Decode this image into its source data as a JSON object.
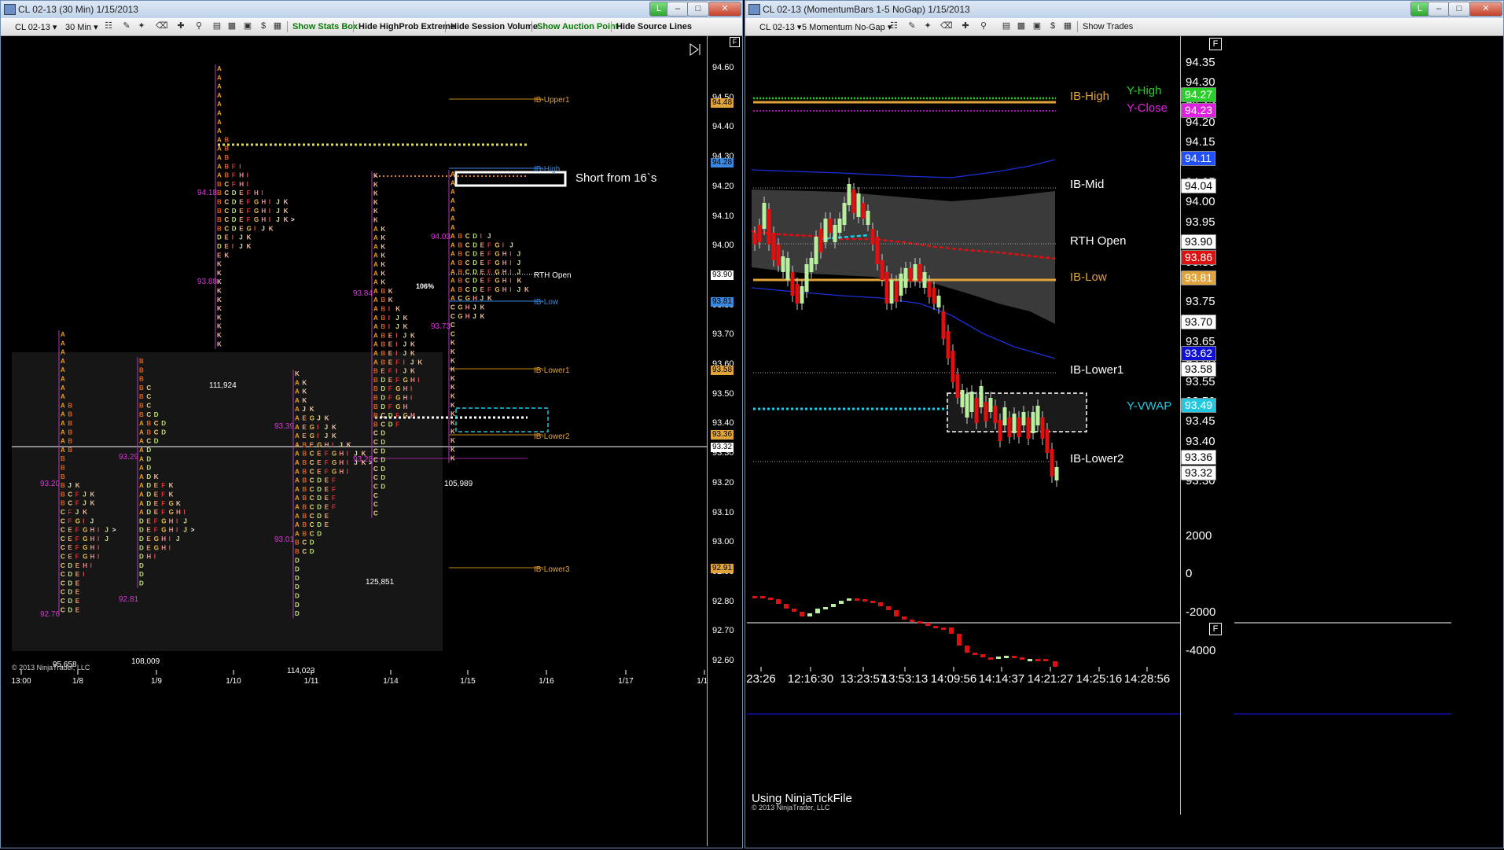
{
  "left_window": {
    "title": "CL 02-13 (30 Min)  1/15/2013",
    "toolbar": {
      "instrument": "CL 02-13",
      "period": "30 Min",
      "buttons": [
        "Show Stats Box",
        "Hide HighProb Extreme",
        "Hide Session Volume",
        "Show Auction Point",
        "Hide Source Lines"
      ]
    },
    "corner_flag": "F",
    "y_ticks": [
      "94.60",
      "94.50",
      "94.40",
      "94.30",
      "94.20",
      "94.10",
      "94.00",
      "93.90",
      "93.80",
      "93.70",
      "93.60",
      "93.50",
      "93.40",
      "93.30",
      "93.20",
      "93.10",
      "93.00",
      "92.90",
      "92.80",
      "92.70",
      "92.60"
    ],
    "price_tags": [
      {
        "label": "94.48",
        "color": "#e0a43a"
      },
      {
        "label": "94.28",
        "color": "#3a88e0"
      },
      {
        "label": "93.90",
        "color": "#ffffff"
      },
      {
        "label": "93.81",
        "color": "#3a88e0"
      },
      {
        "label": "93.58",
        "color": "#e0a43a"
      },
      {
        "label": "93.36",
        "color": "#e0a43a"
      },
      {
        "label": "93.32",
        "color": "#ffffff"
      },
      {
        "label": "92.91",
        "color": "#e0a43a"
      }
    ],
    "x_ticks": [
      "13:00",
      "1/8",
      "1/9",
      "1/10",
      "1/11",
      "1/14",
      "1/15",
      "1/16",
      "1/17",
      "1/18"
    ],
    "level_labels": [
      "IB-Upper1",
      "IB-High",
      "RTH Open",
      "IB-Low",
      "IB-Lower1",
      "IB-Lower2",
      "IB-Lower3"
    ],
    "annotation": "Short from 16`s",
    "percent_label": "106%",
    "volumes": [
      "111,924",
      "105,989",
      "125,851",
      "95,658",
      "108,009",
      "114,023"
    ],
    "profile_prices": [
      "94.18",
      "93.88",
      "93.84",
      "94.03",
      "93.73",
      "93.20",
      "93.29",
      "92.76",
      "92.81",
      "93.39",
      "93.01",
      "93.28"
    ],
    "copyright": "© 2013 NinjaTrader, LLC",
    "profiles": [
      {
        "rows": [
          "A",
          "A",
          "A",
          "A",
          "A",
          "A",
          "A",
          "A",
          "A B",
          "A B",
          "A B",
          "A B",
          "A B",
          "A B",
          "B",
          "B",
          "B",
          "B J K",
          "B C F J K",
          "B C F J K",
          "C F J K",
          "C F G I J",
          "C E F G H I J >",
          "C E F G H I J",
          "C E F G H I",
          "C E F G H I",
          "C D E H I",
          "C D E I",
          "C D E",
          "C D E",
          "C D E",
          "C D E"
        ]
      },
      {
        "rows": [
          "B",
          "B",
          "B",
          "B C",
          "B C",
          "B C",
          "B C D",
          "A B C D",
          "A B C D",
          "A C D",
          "A D",
          "A D",
          "A D",
          "A D K",
          "A D E F K",
          "A D E F K",
          "A D E F G K",
          "A D E F G H I",
          "D E F G H I J",
          "D E F G H I J >",
          "D E G H I J",
          "D E G H I",
          "D H I",
          "D",
          "D",
          "D"
        ]
      },
      {
        "rows": [
          "A",
          "A",
          "A",
          "A",
          "A",
          "A",
          "A",
          "A",
          "A B",
          "A B",
          "A B",
          "A B F I",
          "A B F H I",
          "B C F H I",
          "B C D E F H I",
          "B C D E F G H I J K",
          "B C D E F G H I J K",
          "B C D E F G H I J K >",
          "B C D E G I J K",
          "D E I J K",
          "D E I J K",
          "E K",
          "K",
          "K",
          "K",
          "K",
          "K",
          "K",
          "K",
          "K",
          "K",
          "K"
        ]
      },
      {
        "rows": [
          "K",
          "A K",
          "A K",
          "A K",
          "A J K",
          "A E G J K",
          "A E G I J K",
          "A E G I J K",
          "A B E G H I J K",
          "A B C E F G H I J K",
          "A B C E F G H I J K >",
          "A B C E F G H I",
          "A B C D E F",
          "A B C D E F",
          "A B C D E F",
          "A B C D E F",
          "A B C D E",
          "A B C D E",
          "A B C D",
          "B C D",
          "B C D",
          "D",
          "D",
          "D",
          "D",
          "D",
          "D",
          "D"
        ]
      },
      {
        "rows": [
          "K",
          "K",
          "K",
          "K",
          "K",
          "K",
          "A K",
          "A K",
          "A K",
          "A K",
          "A K",
          "A K",
          "A K",
          "A B K",
          "A B K",
          "A B I K",
          "A B I J K",
          "A B I J K",
          "A B E I J K",
          "A B E I J K",
          "A B E I J K",
          "A B E F I J K",
          "B E F I J K",
          "B D E F G H I",
          "B D F G H I",
          "B D F G H I",
          "B D F G H",
          "B C D F G H",
          "B C D F",
          "C D",
          "C D",
          "C D",
          "C D",
          "C D",
          "C D",
          "C D",
          "C",
          "C",
          "C"
        ]
      },
      {
        "rows": [
          "A",
          "A",
          "A",
          "A",
          "A",
          "A",
          "A",
          "A B C D I J",
          "A B C D E F G I J",
          "A B C D E F G H I J",
          "A B C D E F G H I J",
          "A B C D E F G H I J",
          "A B C D E F G H I K",
          "A B C D E F G H I J K",
          "A C G H J K",
          "C G H J K",
          "C G H J K",
          "C",
          "C",
          "K",
          "K",
          "K",
          "K",
          "K",
          "K",
          "K",
          "K",
          "K",
          "K",
          "K",
          "K",
          "K",
          "K"
        ]
      }
    ]
  },
  "right_window": {
    "title": "CL 02-13 (MomentumBars 1-5 NoGap)  1/15/2013",
    "toolbar": {
      "instrument": "CL 02-13",
      "period": "5 Momentum No-Gap",
      "buttons": [
        "Show Trades"
      ]
    },
    "corner_flag": "F",
    "y_ticks": [
      "94.35",
      "94.30",
      "94.25",
      "94.20",
      "94.15",
      "94.10",
      "94.05",
      "94.00",
      "93.95",
      "93.90",
      "93.85",
      "93.80",
      "93.75",
      "93.70",
      "93.65",
      "93.60",
      "93.55",
      "93.50",
      "93.45",
      "93.40",
      "93.35",
      "93.30"
    ],
    "price_tags": [
      {
        "label": "94.27",
        "color": "#28d028"
      },
      {
        "label": "94.23",
        "color": "#e020e0"
      },
      {
        "label": "94.11",
        "color": "#2050ff"
      },
      {
        "label": "94.04",
        "color": "#ffffff"
      },
      {
        "label": "93.90",
        "color": "#ffffff"
      },
      {
        "label": "93.86",
        "color": "#e01010"
      },
      {
        "label": "93.81",
        "color": "#e0a43a"
      },
      {
        "label": "93.70",
        "color": "#ffffff"
      },
      {
        "label": "93.62",
        "color": "#1010d8"
      },
      {
        "label": "93.58",
        "color": "#ffffff"
      },
      {
        "label": "93.49",
        "color": "#20c8e0"
      },
      {
        "label": "93.36",
        "color": "#ffffff"
      },
      {
        "label": "93.32",
        "color": "#ffffff"
      }
    ],
    "level_labels": [
      {
        "label": "IB-High",
        "color": "#e0a43a"
      },
      {
        "label": "Y-High",
        "color": "#28d028"
      },
      {
        "label": "Y-Close",
        "color": "#e020e0"
      },
      {
        "label": "IB-Mid",
        "color": "#ffffff"
      },
      {
        "label": "RTH Open",
        "color": "#ffffff"
      },
      {
        "label": "IB-Low",
        "color": "#e0a43a"
      },
      {
        "label": "IB-Lower1",
        "color": "#ffffff"
      },
      {
        "label": "Y-VWAP",
        "color": "#20c8e0"
      },
      {
        "label": "IB-Lower2",
        "color": "#ffffff"
      }
    ],
    "sub_y_ticks": [
      "2000",
      "0",
      "-2000",
      "-4000"
    ],
    "sub_corner_flag": "F",
    "x_ticks": [
      "23:26",
      "12:16:30",
      "13:23:57",
      "13:53:13",
      "14:09:56",
      "14:14:37",
      "14:21:27",
      "14:25:16",
      "14:28:56"
    ],
    "watermark": "Using NinjaTickFile",
    "copyright": "© 2013 NinjaTrader, LLC"
  }
}
